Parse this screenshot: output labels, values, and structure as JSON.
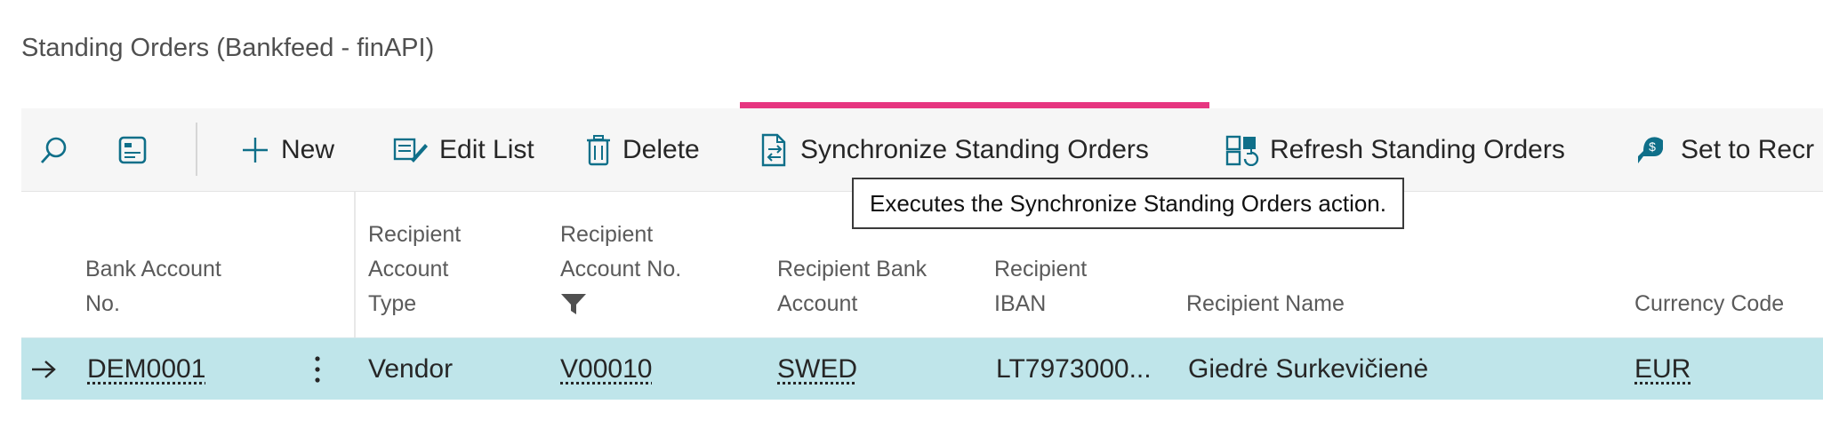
{
  "page": {
    "title": "Standing Orders (Bankfeed - finAPI)"
  },
  "toolbar": {
    "search_icon": "search-icon",
    "view_icon": "layout-icon",
    "new_label": "New",
    "edit_list_label": "Edit List",
    "delete_label": "Delete",
    "synchronize_label": "Synchronize Standing Orders",
    "refresh_label": "Refresh Standing Orders",
    "set_to_label": "Set to Recr"
  },
  "tooltip": {
    "text": "Executes the Synchronize Standing Orders action."
  },
  "table": {
    "headers": {
      "bank_account_no": [
        "Bank Account",
        "No."
      ],
      "recipient_account_type": [
        "Recipient",
        "Account",
        "Type"
      ],
      "recipient_account_no": [
        "Recipient",
        "Account No."
      ],
      "recipient_bank_account": [
        "Recipient Bank",
        "Account"
      ],
      "recipient_iban": [
        "Recipient",
        "IBAN"
      ],
      "recipient_name": "Recipient Name",
      "currency_code": "Currency Code"
    },
    "rows": [
      {
        "bank_account_no": "DEM0001",
        "recipient_account_type": "Vendor",
        "recipient_account_no": "V00010",
        "recipient_bank_account": "SWED",
        "recipient_iban": "LT7973000...",
        "recipient_name": "Giedrė Surkevičienė",
        "currency_code": "EUR"
      }
    ]
  },
  "colors": {
    "highlight": "#e63680",
    "selected_row": "#bfe5ea",
    "accent": "#0f6f89"
  }
}
